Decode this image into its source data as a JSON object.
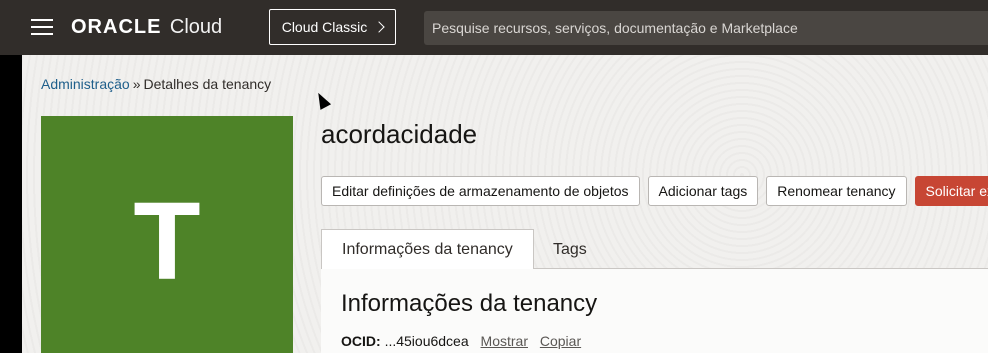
{
  "header": {
    "brand": "ORACLE",
    "product": "Cloud",
    "classic_button": "Cloud Classic",
    "search_placeholder": "Pesquise recursos, serviços, documentação e Marketplace"
  },
  "breadcrumb": {
    "parent": "Administração",
    "separator": "»",
    "current": "Detalhes da tenancy"
  },
  "tenancy": {
    "initial": "T",
    "name": "acordacidade",
    "tile_color": "#4e8328"
  },
  "actions": [
    {
      "label": "Editar definições de armazenamento de objetos"
    },
    {
      "label": "Adicionar tags"
    },
    {
      "label": "Renomear tenancy"
    },
    {
      "label": "Solicitar ex"
    }
  ],
  "tabs": [
    {
      "label": "Informações da tenancy",
      "active": true
    },
    {
      "label": "Tags",
      "active": false
    }
  ],
  "panel": {
    "title": "Informações da tenancy",
    "ocid_label": "OCID:",
    "ocid_value": "...45iou6dcea",
    "show_link": "Mostrar",
    "copy_link": "Copiar"
  }
}
